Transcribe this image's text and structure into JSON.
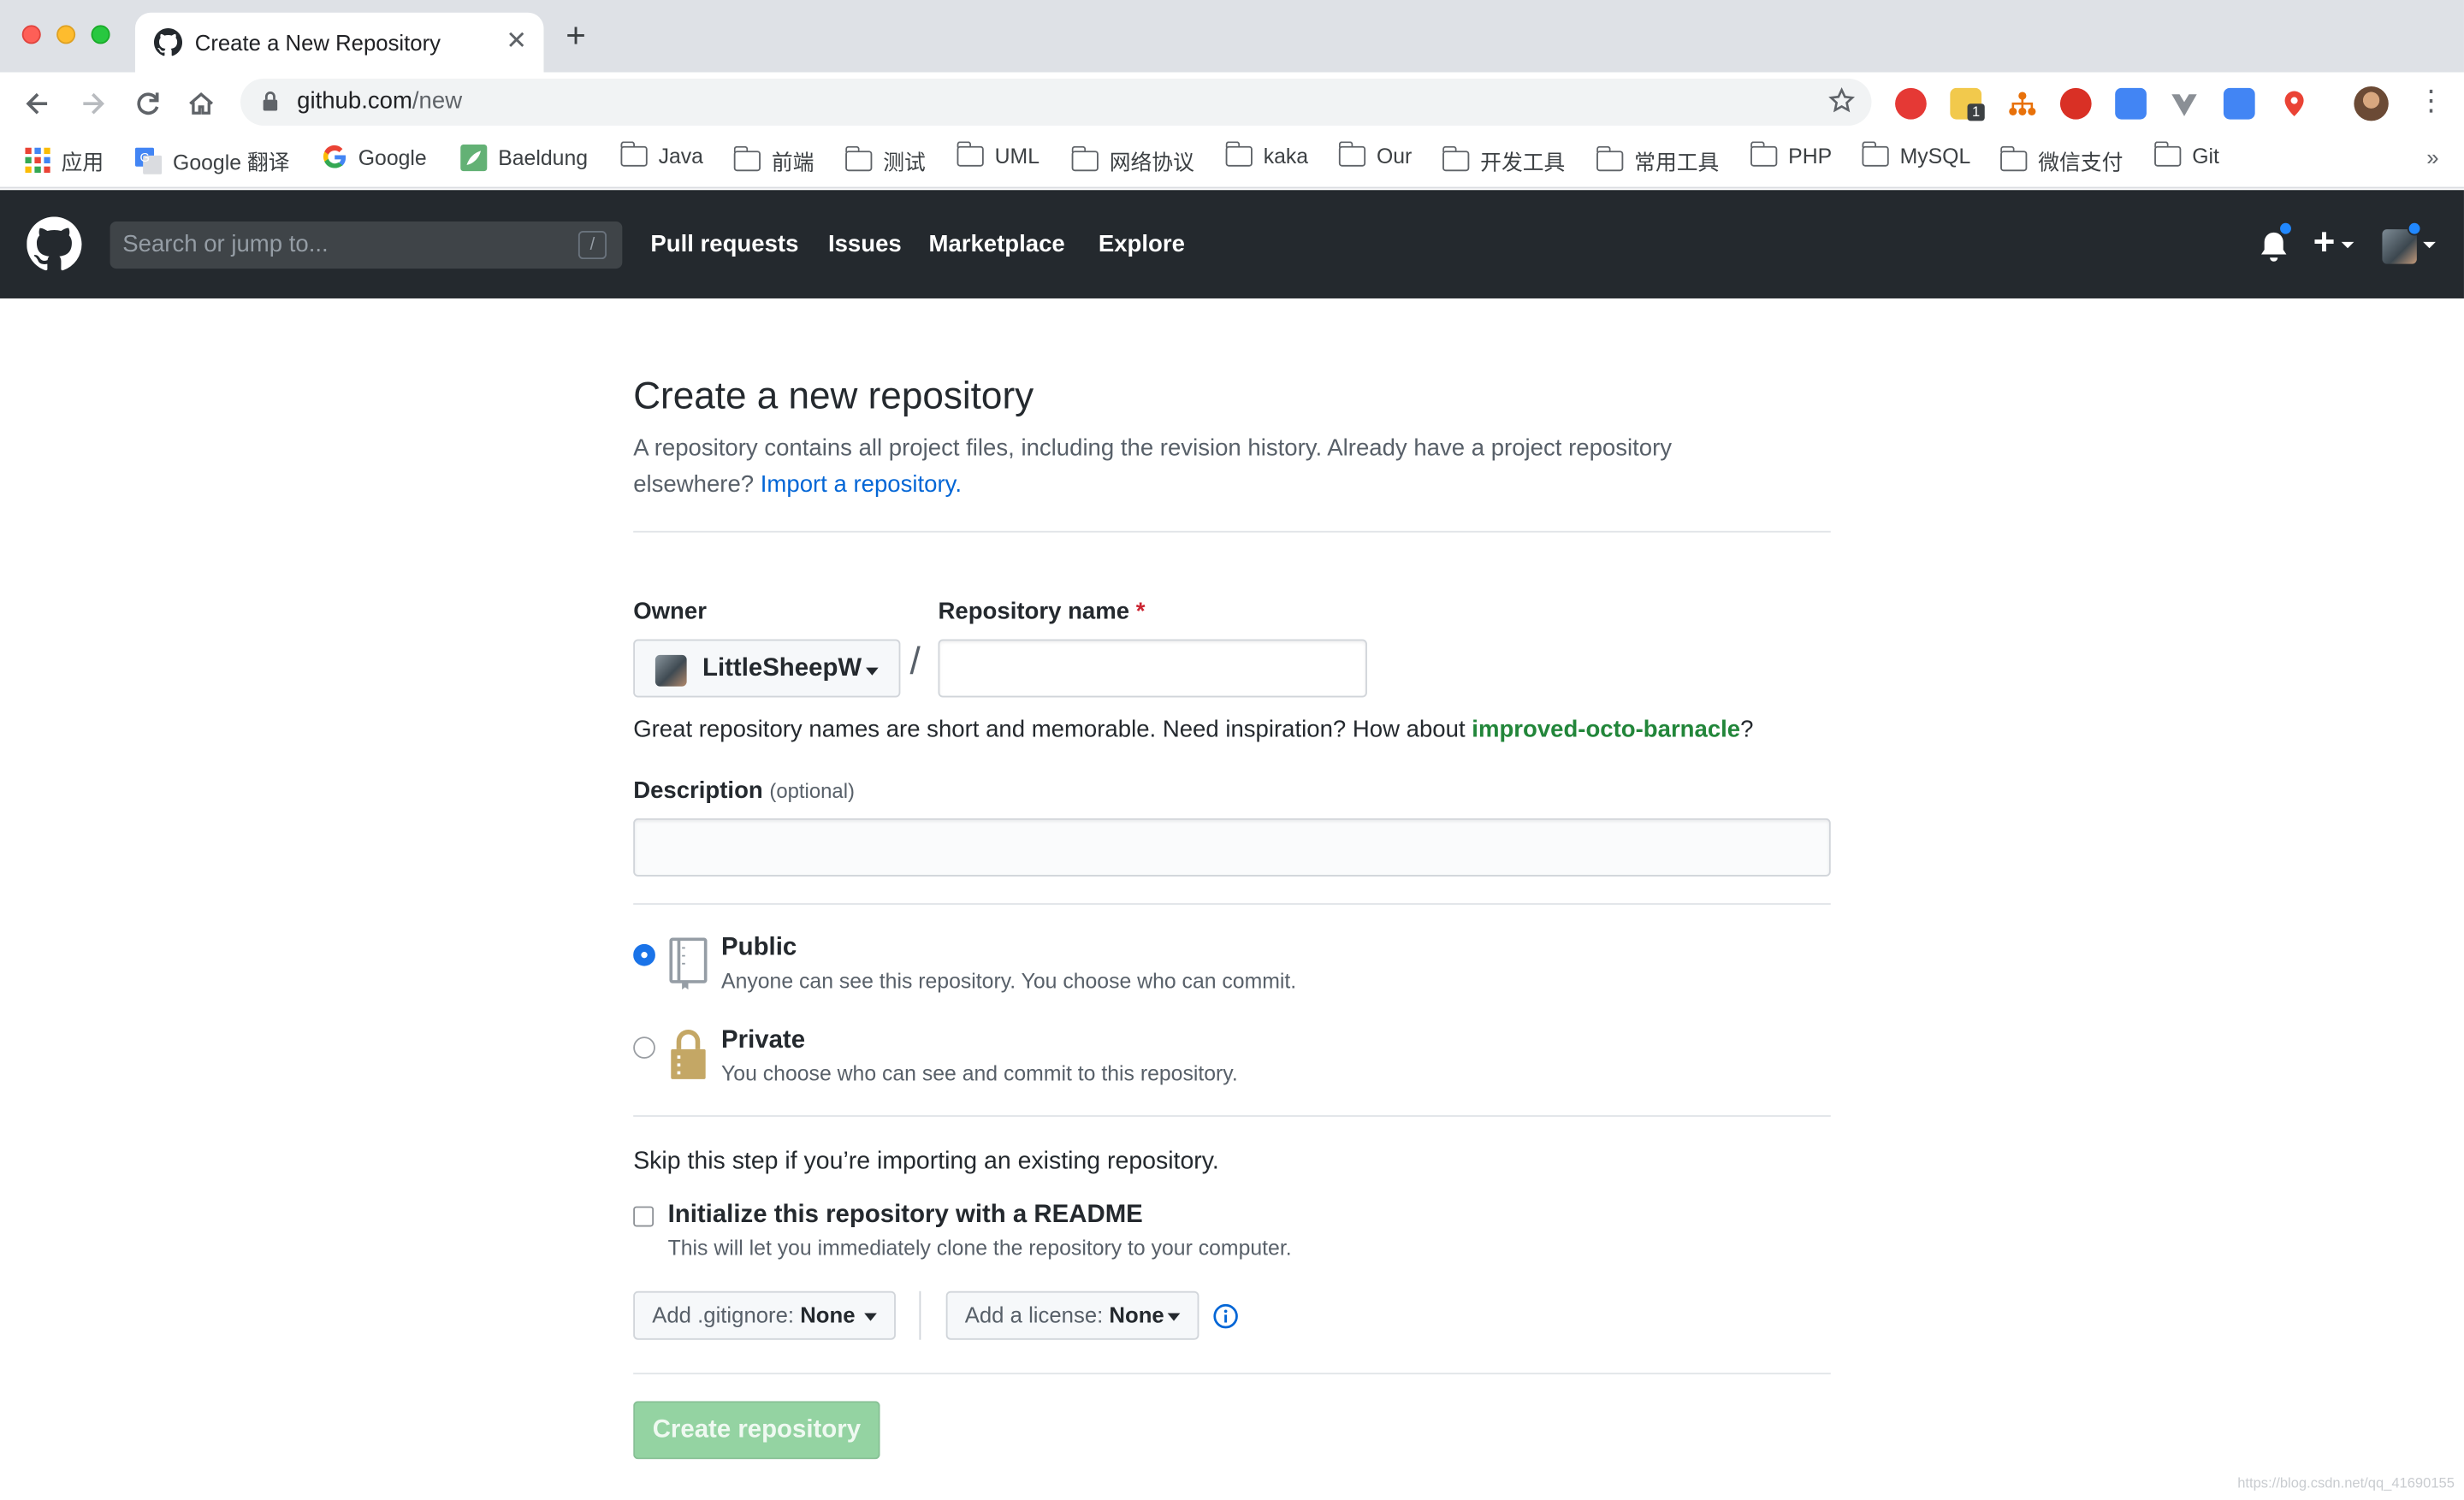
{
  "browser": {
    "tab_title": "Create a New Repository",
    "url_host": "github.com",
    "url_path": "/new",
    "bookmarks": [
      {
        "label": "应用",
        "icon": "apps-grid-icon"
      },
      {
        "label": "Google 翻译",
        "icon": "google-translate-icon"
      },
      {
        "label": "Google",
        "icon": "google-icon"
      },
      {
        "label": "Baeldung",
        "icon": "baeldung-icon"
      },
      {
        "label": "Java",
        "icon": "folder-icon"
      },
      {
        "label": "前端",
        "icon": "folder-icon"
      },
      {
        "label": "测试",
        "icon": "folder-icon"
      },
      {
        "label": "UML",
        "icon": "folder-icon"
      },
      {
        "label": "网络协议",
        "icon": "folder-icon"
      },
      {
        "label": "kaka",
        "icon": "folder-icon"
      },
      {
        "label": "Our",
        "icon": "folder-icon"
      },
      {
        "label": "开发工具",
        "icon": "folder-icon"
      },
      {
        "label": "常用工具",
        "icon": "folder-icon"
      },
      {
        "label": "PHP",
        "icon": "folder-icon"
      },
      {
        "label": "MySQL",
        "icon": "folder-icon"
      },
      {
        "label": "微信支付",
        "icon": "folder-icon"
      },
      {
        "label": "Git",
        "icon": "folder-icon"
      }
    ],
    "bookmarks_more": "»",
    "extension_badge": "1"
  },
  "github_header": {
    "search_placeholder": "Search or jump to...",
    "search_key": "/",
    "nav": [
      "Pull requests",
      "Issues",
      "Marketplace",
      "Explore"
    ]
  },
  "page": {
    "title": "Create a new repository",
    "lead_text": "A repository contains all project files, including the revision history. Already have a project repository elsewhere?",
    "import_link": "Import a repository.",
    "owner_label": "Owner",
    "owner_name": "LittleSheepW",
    "repo_name_label": "Repository name",
    "required_mark": "*",
    "slash": "/",
    "repo_name_value": "",
    "hint_prefix": "Great repository names are short and memorable. Need inspiration? How about",
    "hint_suggestion": "improved-octo-barnacle",
    "hint_suffix": "?",
    "description_label": "Description",
    "description_optional": "(optional)",
    "description_value": "",
    "visibility": {
      "public_title": "Public",
      "public_desc": "Anyone can see this repository. You choose who can commit.",
      "private_title": "Private",
      "private_desc": "You choose who can see and commit to this repository.",
      "selected": "Public"
    },
    "skip_text": "Skip this step if you’re importing an existing repository.",
    "readme_title": "Initialize this repository with a README",
    "readme_desc": "This will let you immediately clone the repository to your computer.",
    "readme_checked": false,
    "gitignore_label": "Add .gitignore:",
    "gitignore_value": "None",
    "license_label": "Add a license:",
    "license_value": "None",
    "create_button": "Create repository"
  },
  "watermark": "https://blog.csdn.net/qq_41690155",
  "colors": {
    "header_bg": "#24292e",
    "link": "#0366d6",
    "suggestion": "#22863a",
    "create_disabled": "#94d3a2",
    "required": "#cb2431"
  }
}
